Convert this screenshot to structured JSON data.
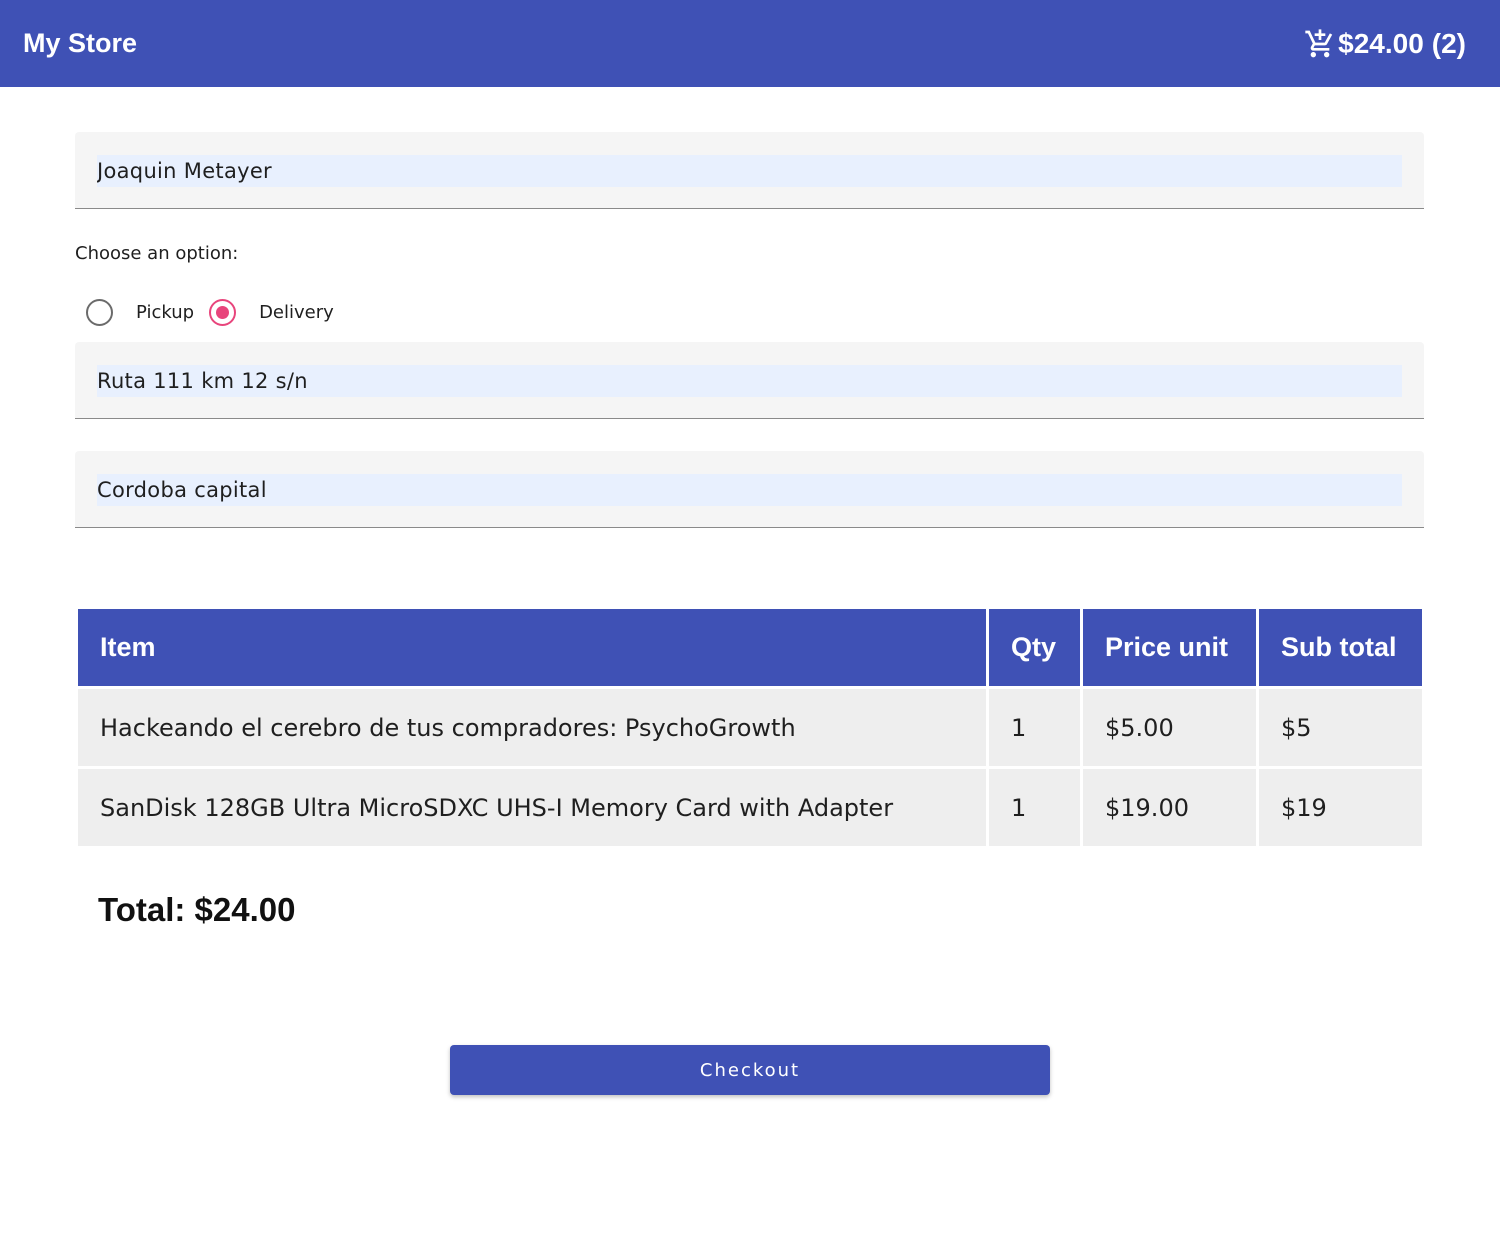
{
  "toolbar": {
    "title": "My Store",
    "cart_icon": "add-shopping-cart-icon",
    "cart_total": "$24.00",
    "cart_count": "(2)"
  },
  "form": {
    "name_value": "Joaquin Metayer",
    "option_label": "Choose an option:",
    "options": [
      {
        "label": "Pickup",
        "selected": false
      },
      {
        "label": "Delivery",
        "selected": true
      }
    ],
    "address_value": "Ruta 111 km 12 s/n",
    "city_value": "Cordoba capital"
  },
  "table": {
    "headers": [
      "Item",
      "Qty",
      "Price unit",
      "Sub total"
    ],
    "rows": [
      [
        "Hackeando el cerebro de tus compradores: PsychoGrowth",
        "1",
        "$5.00",
        "$5"
      ],
      [
        "SanDisk 128GB Ultra MicroSDXC UHS-I Memory Card with Adapter",
        "1",
        "$19.00",
        "$19"
      ]
    ]
  },
  "total_label": "Total: $24.00",
  "checkout_label": "Checkout",
  "colors": {
    "primary": "#3f51b5",
    "accent": "#e8457c",
    "autofill": "#e8f0fe"
  }
}
